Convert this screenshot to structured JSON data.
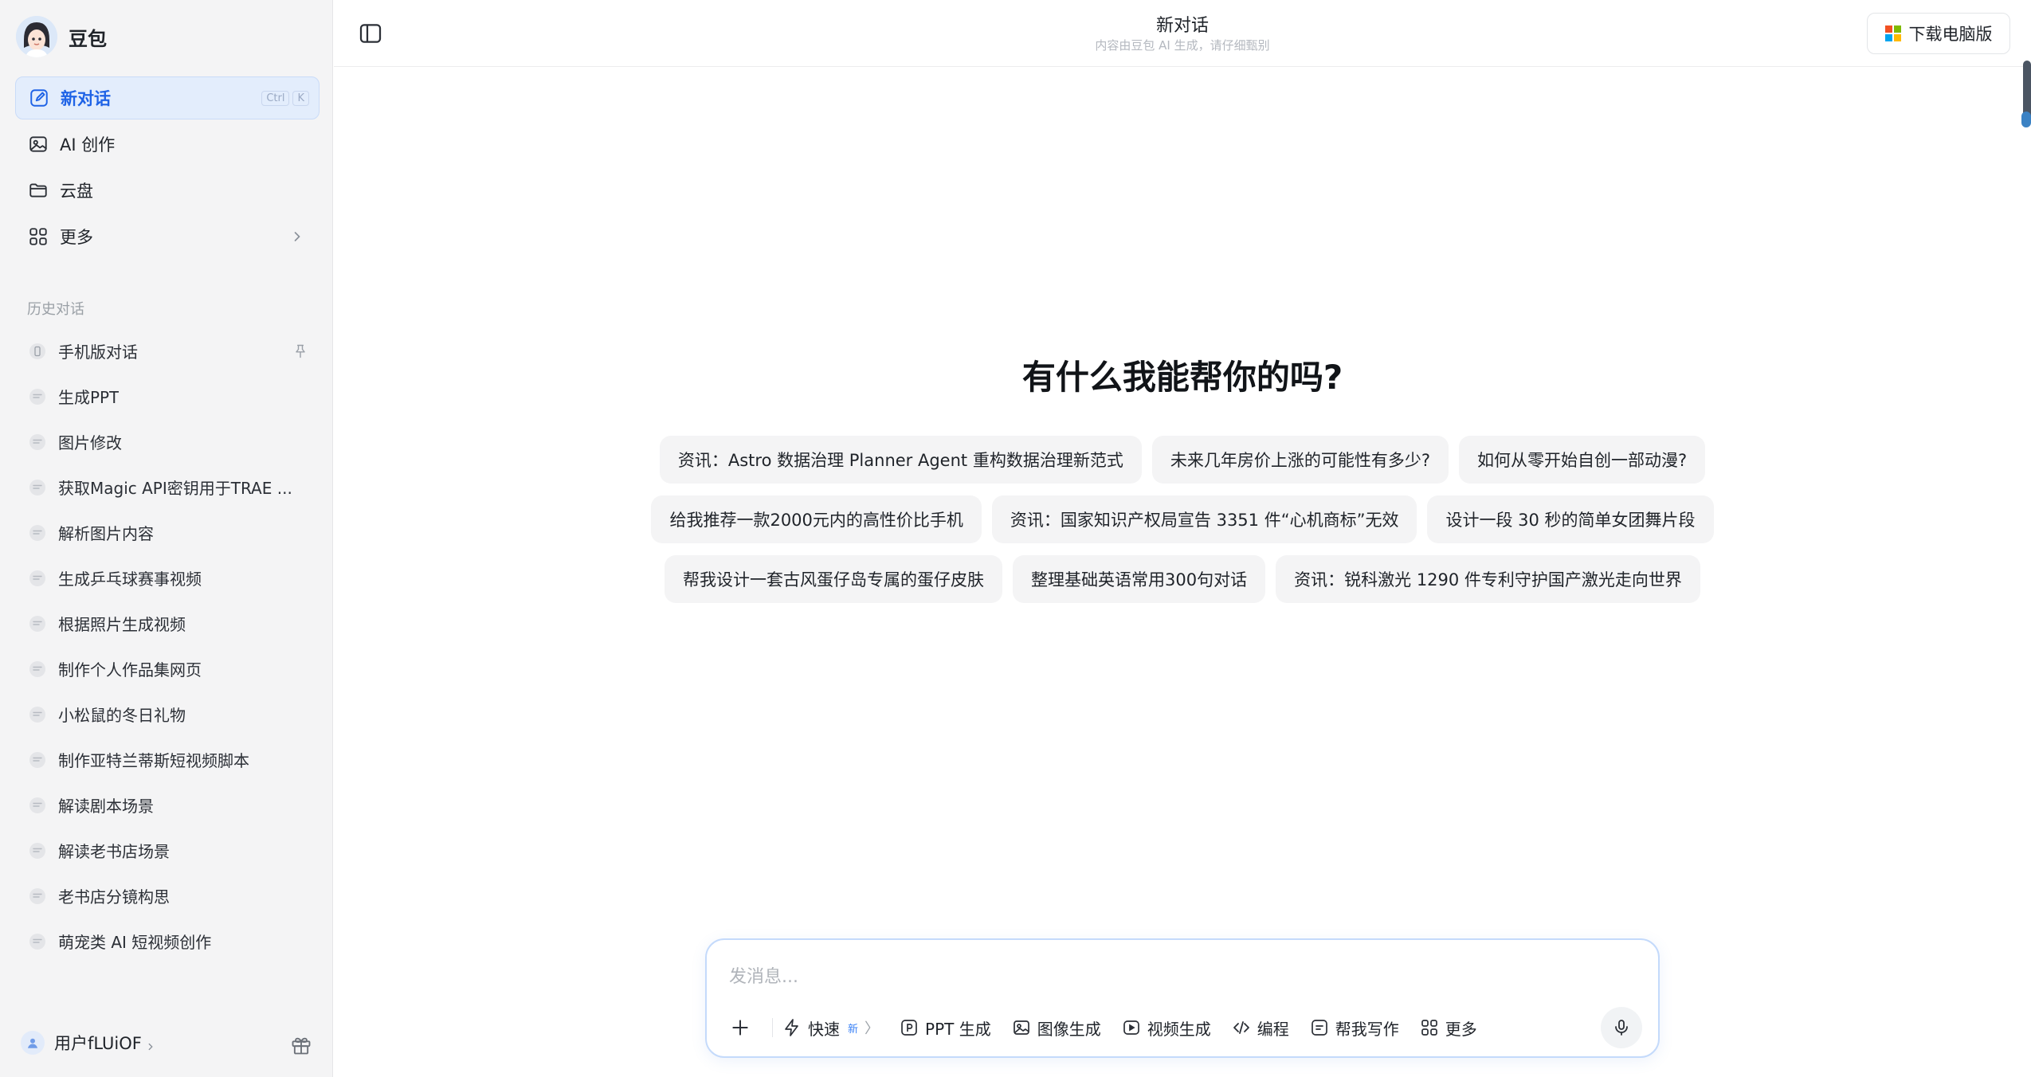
{
  "app": {
    "name": "豆包"
  },
  "sidebar": {
    "nav": [
      {
        "label": "新对话",
        "icon": "edit-icon",
        "active": true,
        "shortcut": [
          "Ctrl",
          "K"
        ]
      },
      {
        "label": "AI 创作",
        "icon": "image-icon"
      },
      {
        "label": "云盘",
        "icon": "folder-icon"
      },
      {
        "label": "更多",
        "icon": "grid-icon"
      }
    ],
    "history_title": "历史对话",
    "history": [
      {
        "label": "手机版对话",
        "icon": "phone-icon",
        "pinned": true
      },
      {
        "label": "生成PPT",
        "icon": "chat-bubble-icon"
      },
      {
        "label": "图片修改",
        "icon": "chat-bubble-icon"
      },
      {
        "label": "获取Magic API密钥用于TRAE ...",
        "icon": "chat-bubble-icon"
      },
      {
        "label": "解析图片内容",
        "icon": "chat-bubble-icon"
      },
      {
        "label": "生成乒乓球赛事视频",
        "icon": "chat-bubble-icon"
      },
      {
        "label": "根据照片生成视频",
        "icon": "chat-bubble-icon"
      },
      {
        "label": "制作个人作品集网页",
        "icon": "chat-bubble-icon"
      },
      {
        "label": "小松鼠的冬日礼物",
        "icon": "chat-bubble-icon"
      },
      {
        "label": "制作亚特兰蒂斯短视频脚本",
        "icon": "chat-bubble-icon"
      },
      {
        "label": "解读剧本场景",
        "icon": "chat-bubble-icon"
      },
      {
        "label": "解读老书店场景",
        "icon": "chat-bubble-icon"
      },
      {
        "label": "老书店分镜构思",
        "icon": "chat-bubble-icon"
      },
      {
        "label": "萌宠类 AI 短视频创作",
        "icon": "chat-bubble-icon"
      }
    ],
    "user": {
      "name": "用户fLUiOF"
    }
  },
  "header": {
    "title": "新对话",
    "subtitle": "内容由豆包 AI 生成，请仔细甄别",
    "download_label": "下载电脑版"
  },
  "main": {
    "heading": "有什么我能帮你的吗?",
    "suggestions": [
      [
        "资讯：Astro 数据治理 Planner Agent 重构数据治理新范式",
        "未来几年房价上涨的可能性有多少?",
        "如何从零开始自创一部动漫?"
      ],
      [
        "给我推荐一款2000元内的高性价比手机",
        "资讯：国家知识产权局宣告 3351 件“心机商标”无效",
        "设计一段 30 秒的简单女团舞片段"
      ],
      [
        "帮我设计一套古风蛋仔岛专属的蛋仔皮肤",
        "整理基础英语常用300句对话",
        "资讯：锐科激光 1290 件专利守护国产激光走向世界"
      ]
    ]
  },
  "composer": {
    "placeholder": "发消息...",
    "tools": [
      {
        "label": "快速",
        "icon": "lightning-icon",
        "badge": "新",
        "chevron": "〉"
      },
      {
        "label": "PPT 生成",
        "icon": "ppt-icon"
      },
      {
        "label": "图像生成",
        "icon": "image-gen-icon"
      },
      {
        "label": "视频生成",
        "icon": "video-icon"
      },
      {
        "label": "编程",
        "icon": "code-icon"
      },
      {
        "label": "帮我写作",
        "icon": "write-icon"
      },
      {
        "label": "更多",
        "icon": "more-grid-icon"
      }
    ]
  },
  "colors": {
    "accent": "#1f63e6",
    "active_bg": "#e3edfc",
    "sidebar_bg": "#f4f4f5",
    "chip_bg": "#f4f4f5",
    "composer_border": "#c4dafb"
  }
}
